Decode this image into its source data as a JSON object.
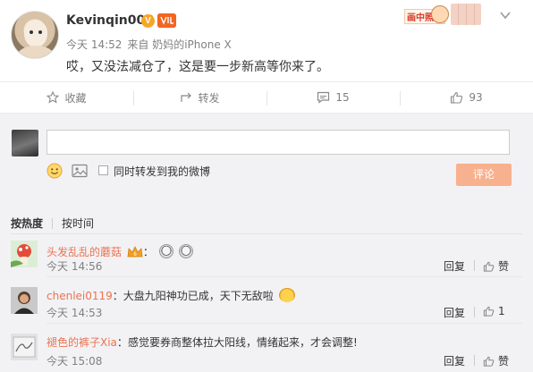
{
  "post": {
    "username": "Kevinqin008",
    "verified_badge": "V",
    "time": "今天 14:52",
    "source": "来自 奶妈的iPhone X",
    "text": "哎，又没法减仓了，这是要一步新高等你来了。",
    "sticker_label": "画中照山",
    "icons": {
      "verified": "v-badge-icon",
      "more": "chevron-down-icon"
    }
  },
  "actions": [
    {
      "label": "收藏",
      "icon": "star-icon"
    },
    {
      "label": "转发",
      "icon": "share-icon"
    },
    {
      "label": "15",
      "icon": "comment-icon"
    },
    {
      "label": "93",
      "icon": "thumbs-up-icon"
    }
  ],
  "composer": {
    "placeholder": "",
    "forward_label": "同时转发到我的微博",
    "submit_label": "评论"
  },
  "sort": {
    "by_hot": "按热度",
    "by_time": "按时间"
  },
  "comments": [
    {
      "user": "头发乱乱的蘑菇",
      "suffix": "：",
      "text": "",
      "time": "今天 14:56",
      "reply": "回复",
      "like_label": "赞"
    },
    {
      "user": "chenlei0119",
      "suffix": "：",
      "text": "大盘九阳神功已成，天下无敌啦",
      "time": "今天 14:53",
      "reply": "回复",
      "like_label": "1"
    },
    {
      "user": "褪色的裤子Xia",
      "suffix": "：",
      "text": "感觉要券商整体拉大阳线，情绪起来，才会调整!",
      "time": "今天 15:08",
      "reply": "回复",
      "like_label": "赞"
    }
  ],
  "colors": {
    "accent": "#eb7350",
    "submit": "#f8b18e",
    "badge": "#f6a623",
    "background": "#f2f2f5"
  }
}
